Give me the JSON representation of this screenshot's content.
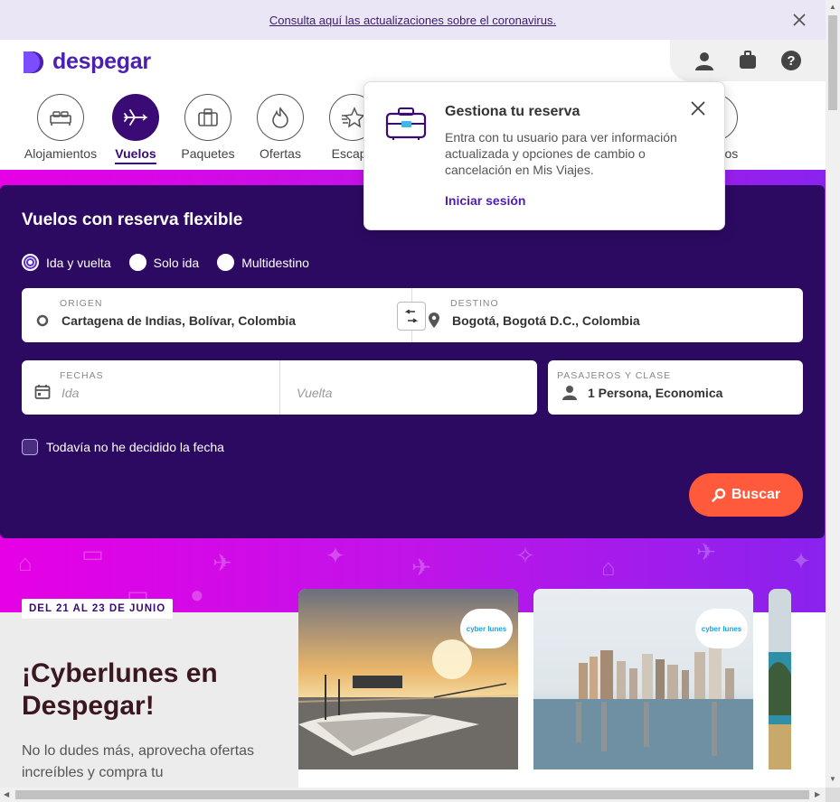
{
  "covid_banner": {
    "link_text": "Consulta aquí las actualizaciones sobre el coronavirus."
  },
  "header": {
    "brand": "despegar",
    "icons": [
      "user-icon",
      "suitcase-icon",
      "help-icon"
    ]
  },
  "nav": {
    "items": [
      {
        "label": "Alojamientos",
        "icon": "bed-icon",
        "active": false
      },
      {
        "label": "Vuelos",
        "icon": "airplane-icon",
        "active": true
      },
      {
        "label": "Paquetes",
        "icon": "suitcase-icon",
        "active": false
      },
      {
        "label": "Ofertas",
        "icon": "flame-icon",
        "active": false
      },
      {
        "label": "Escapa",
        "icon": "star-icon",
        "active": false
      },
      {
        "label": "dos",
        "icon": "circle-icon",
        "active": false
      }
    ]
  },
  "popup": {
    "title": "Gestiona tu reserva",
    "body": "Entra con tu usuario para ver información actualizada y opciones de cambio o cancelación en Mis Viajes.",
    "link": "Iniciar sesión"
  },
  "search": {
    "title": "Vuelos con reserva flexible",
    "trip_types": [
      {
        "label": "Ida y vuelta",
        "checked": true
      },
      {
        "label": "Solo ida",
        "checked": false
      },
      {
        "label": "Multidestino",
        "checked": false
      }
    ],
    "origin": {
      "caption": "ORIGEN",
      "value": "Cartagena de Indias, Bolívar, Colombia"
    },
    "destination": {
      "caption": "DESTINO",
      "value": "Bogotá, Bogotá D.C., Colombia"
    },
    "dates": {
      "caption": "FECHAS",
      "ida_placeholder": "Ida",
      "vuelta_placeholder": "Vuelta"
    },
    "passengers": {
      "caption": "PASAJEROS Y CLASE",
      "value": "1 Persona, Economica"
    },
    "undecided_label": "Todavía no he decidido la fecha",
    "search_button": "Buscar"
  },
  "promo": {
    "date_badge": "DEL 21 AL 23 DE JUNIO",
    "title": "¡Cyberlunes en Despegar!",
    "text": "No lo dudes más, aprovecha ofertas increíbles y compra tu",
    "card_badge": "cyber lunes"
  },
  "colors": {
    "brand": "#4b1fb0",
    "panel": "#2d0a62",
    "search_button": "#ff5a3c",
    "banner": "#ebe6f5"
  }
}
